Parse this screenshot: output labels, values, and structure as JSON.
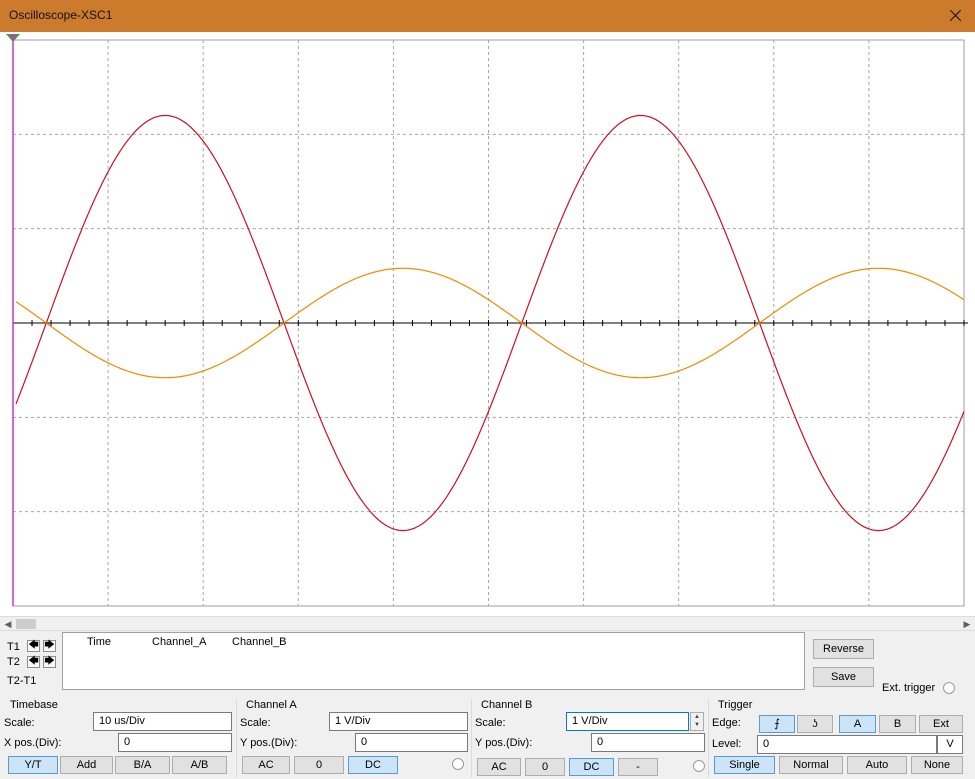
{
  "window": {
    "title": "Oscilloscope-XSC1"
  },
  "colors": {
    "titlebar": "#cc7a2b",
    "channel_a": "#cc1024",
    "channel_b": "#f08a00",
    "cursor_t1": "#cc33cc",
    "cursor_t2": "#33aa33",
    "grid": "#a8a8a8"
  },
  "icons": {
    "close": "close-icon",
    "scroll_left": "chevron-left-icon",
    "scroll_right": "chevron-right-icon",
    "cursor_left": "arrow-left-icon",
    "cursor_right": "arrow-right-icon",
    "rising_edge": "rising-edge-icon",
    "falling_edge": "falling-edge-icon"
  },
  "chart_data": {
    "type": "line",
    "x_divisions": 10,
    "y_divisions": 6,
    "x_range_div": [
      0,
      10
    ],
    "y_range_div": [
      -3,
      3
    ],
    "grid": true,
    "center_axis_ticks": true,
    "series": [
      {
        "channel": "A",
        "color": "#cc1024",
        "amplitude_div": 2.2,
        "period_div": 5,
        "phase_crossing_div": 0.35,
        "direction": "rising"
      },
      {
        "channel": "B",
        "color": "#f08a00",
        "amplitude_div": 0.58,
        "period_div": 5,
        "phase_crossing_div": 0.35,
        "direction": "falling"
      }
    ]
  },
  "cursors": {
    "t1_label": "T1",
    "t2_label": "T2",
    "t2t1_label": "T2-T1",
    "left_arrow": "🡄",
    "right_arrow": "🡆",
    "columns": [
      "Time",
      "Channel_A",
      "Channel_B"
    ]
  },
  "actions": {
    "reverse_label": "Reverse",
    "save_label": "Save",
    "ext_trigger_label": "Ext. trigger"
  },
  "timebase": {
    "title": "Timebase",
    "scale_label": "Scale:",
    "scale_value": "10 us/Div",
    "xpos_label": "X pos.(Div):",
    "xpos_value": "0",
    "modes": [
      "Y/T",
      "Add",
      "B/A",
      "A/B"
    ],
    "active_mode": "Y/T"
  },
  "channel_a": {
    "title": "Channel A",
    "scale_label": "Scale:",
    "scale_value": "1  V/Div",
    "ypos_label": "Y pos.(Div):",
    "ypos_value": "0",
    "coupling": [
      "AC",
      "0",
      "DC"
    ],
    "active_coupling": "DC"
  },
  "channel_b": {
    "title": "Channel B",
    "scale_label": "Scale:",
    "scale_value": "1  V/Div",
    "ypos_label": "Y pos.(Div):",
    "ypos_value": "0",
    "coupling": [
      "AC",
      "0",
      "DC",
      "-"
    ],
    "active_coupling": "DC"
  },
  "trigger": {
    "title": "Trigger",
    "edge_label": "Edge:",
    "rising_glyph": "⨍",
    "falling_glyph": "ʖ",
    "sources": [
      "A",
      "B",
      "Ext"
    ],
    "active_source": "A",
    "level_label": "Level:",
    "level_value": "0",
    "level_unit": "V",
    "modes": [
      "Single",
      "Normal",
      "Auto",
      "None"
    ],
    "active_mode": "Single"
  }
}
